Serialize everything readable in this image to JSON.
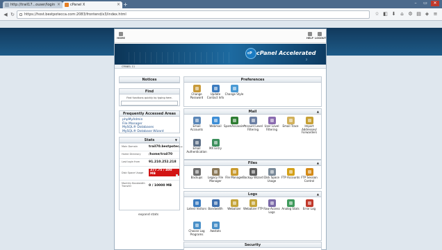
{
  "browser": {
    "tabs": [
      {
        "title": "http://trail17...ouser/login"
      },
      {
        "title": "cPanel X"
      }
    ],
    "new_tab": "+",
    "url": "https://host.bestpotecca.com:2083/frontend/x3/index.html",
    "window_controls": [
      "–",
      "▭",
      "✕"
    ]
  },
  "cpanel": {
    "topnav": [
      "HOME",
      "HELP",
      "LOGOUT"
    ],
    "brand": "cPanel Accelerated",
    "brand_tag": "2",
    "crumb": "CPANEL 11",
    "notices_title": "Notices",
    "find": {
      "title": "Find",
      "hint": "Find functions quickly by typing here."
    },
    "frequent": {
      "title": "Frequently Accessed Areas",
      "items": [
        "phpMyAdmin",
        "File Manager",
        "MySQL® Databases",
        "MySQL® Database Wizard"
      ]
    },
    "stats": {
      "title": "Stats",
      "rows": [
        {
          "label": "Main Domain",
          "value": "trail70.bestpotec..."
        },
        {
          "label": "Home Directory",
          "value": "/home/trail70"
        },
        {
          "label": "Last login from",
          "value": "91.210.252.218"
        },
        {
          "label": "Disk Space Usage",
          "value": "377.75 / 400 MB",
          "fill": 0.94
        },
        {
          "label": "Monthly Bandwidth Transfer",
          "value": "0 / 10000 MB"
        }
      ],
      "expand": "expand stats"
    },
    "groups": [
      {
        "title": "Preferences",
        "items": [
          {
            "label": "Change Password",
            "icon": "key-icon",
            "color": "#c89a3a"
          },
          {
            "label": "Update Contact Info",
            "icon": "contact-icon",
            "color": "#3b7bbf"
          },
          {
            "label": "Change Style",
            "icon": "style-icon",
            "color": "#4a9ad4"
          }
        ]
      },
      {
        "title": "Mail",
        "items": [
          {
            "label": "Email Accounts",
            "icon": "email-icon",
            "color": "#5b87b8"
          },
          {
            "label": "Webmail",
            "icon": "webmail-icon",
            "color": "#3d8ed6"
          },
          {
            "label": "SpamAssassin™",
            "icon": "spam-icon",
            "color": "#2e7d32"
          },
          {
            "label": "Account Level Filtering",
            "icon": "filter-icon",
            "color": "#6b7fa3"
          },
          {
            "label": "User Level Filtering",
            "icon": "user-filter-icon",
            "color": "#8a6bb0"
          },
          {
            "label": "Email Trace",
            "icon": "trace-icon",
            "color": "#d2b15a"
          },
          {
            "label": "Import Addresses/ Forwarders",
            "icon": "import-icon",
            "color": "#c7a033"
          },
          {
            "label": "Email Authentication",
            "icon": "auth-icon",
            "color": "#5d6f86"
          },
          {
            "label": "MX Entry",
            "icon": "mx-icon",
            "color": "#3c8f5c"
          }
        ]
      },
      {
        "title": "Files",
        "items": [
          {
            "label": "Backups",
            "icon": "backup-icon",
            "color": "#6d6d6d"
          },
          {
            "label": "Legacy File Manager",
            "icon": "legacy-fm-icon",
            "color": "#8c7a5a"
          },
          {
            "label": "File Manager",
            "icon": "file-manager-icon",
            "color": "#c99a2e"
          },
          {
            "label": "Backup Wizard",
            "icon": "backup-wizard-icon",
            "color": "#5c5c5c"
          },
          {
            "label": "Disk Space Usage",
            "icon": "disk-icon",
            "color": "#7a8a99"
          },
          {
            "label": "FTP Accounts",
            "icon": "ftp-icon",
            "color": "#d4a017"
          },
          {
            "label": "FTP Session Control",
            "icon": "ftp-session-icon",
            "color": "#d48a17"
          }
        ]
      },
      {
        "title": "Logs",
        "items": [
          {
            "label": "Latest Visitors",
            "icon": "visitors-icon",
            "color": "#3b7bbf"
          },
          {
            "label": "Bandwidth",
            "icon": "bandwidth-icon",
            "color": "#3f6fae"
          },
          {
            "label": "Webalizer",
            "icon": "webalizer-icon",
            "color": "#c4a43a"
          },
          {
            "label": "Webalizer FTP",
            "icon": "webalizer-ftp-icon",
            "color": "#c4a43a"
          },
          {
            "label": "Raw Access Logs",
            "icon": "raw-logs-icon",
            "color": "#7b6aa8"
          },
          {
            "label": "Analog Stats",
            "icon": "analog-icon",
            "color": "#3f9a5c"
          },
          {
            "label": "Error Log",
            "icon": "error-log-icon",
            "color": "#c0392b"
          },
          {
            "label": "Choose Log Programs",
            "icon": "log-programs-icon",
            "color": "#4a90c8"
          },
          {
            "label": "Awstats",
            "icon": "awstats-icon",
            "color": "#4a90c8"
          }
        ]
      },
      {
        "title": "Security",
        "items": []
      }
    ]
  }
}
